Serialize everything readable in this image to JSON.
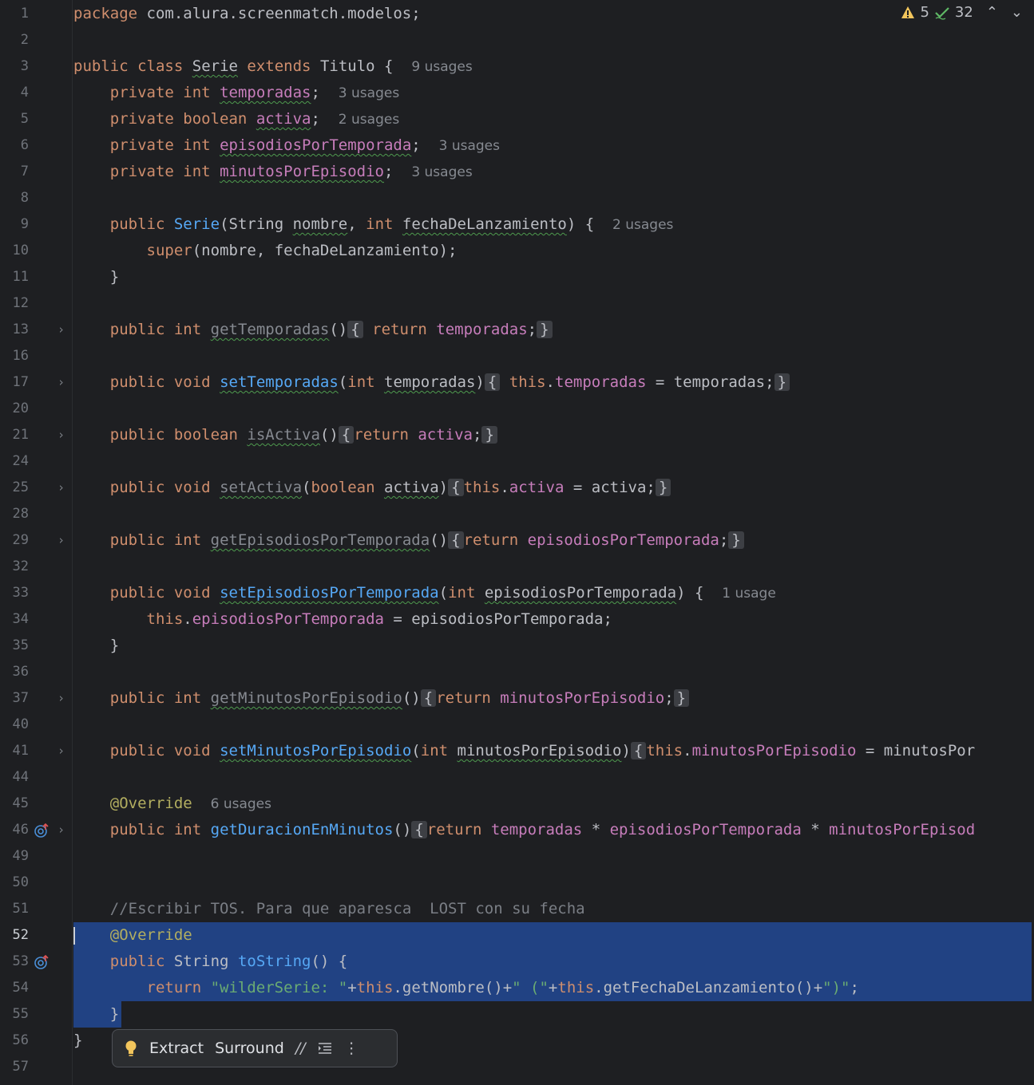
{
  "inspections": {
    "warnings": "5",
    "checks": "32"
  },
  "hints": {
    "usages_9": "9 usages",
    "usages_3": "3 usages",
    "usages_2": "2 usages",
    "usages_1": "1 usage",
    "usages_6": "6 usages"
  },
  "line_numbers": [
    "1",
    "2",
    "3",
    "4",
    "5",
    "6",
    "7",
    "8",
    "9",
    "10",
    "11",
    "12",
    "13",
    "16",
    "17",
    "20",
    "21",
    "24",
    "25",
    "28",
    "29",
    "32",
    "33",
    "34",
    "35",
    "36",
    "37",
    "40",
    "41",
    "44",
    "45",
    "46",
    "49",
    "50",
    "51",
    "52",
    "53",
    "54",
    "55",
    "56",
    "57"
  ],
  "code": {
    "package_kw": "package",
    "package_name": " com.alura.screenmatch.modelos;",
    "public": "public",
    "class": "class",
    "serie": "Serie",
    "extends": "extends",
    "titulo": "Titulo",
    "private": "private",
    "int": "int",
    "boolean": "boolean",
    "void": "void",
    "string": "String",
    "super": "super",
    "this": "this",
    "return": "return",
    "temporadas": "temporadas",
    "activa": "activa",
    "episodiosPorTemporada": "episodiosPorTemporada",
    "minutosPorEpisodio": "minutosPorEpisodio",
    "nombre": "nombre",
    "fechaDeLanzamiento": "fechaDeLanzamiento",
    "getTemporadas": "getTemporadas",
    "setTemporadas": "setTemporadas",
    "isActiva": "isActiva",
    "setActiva": "setActiva",
    "getEpisodiosPorTemporada": "getEpisodiosPorTemporada",
    "setEpisodiosPorTemporada": "setEpisodiosPorTemporada",
    "getMinutosPorEpisodio": "getMinutosPorEpisodio",
    "setMinutosPorEpisodio": "setMinutosPorEpisodio",
    "override": "@Override",
    "getDuracionEnMinutos": "getDuracionEnMinutos",
    "minutosPorEpisod_trunc": "minutosPorEpisod",
    "minutosPor_trunc": "minutosPor",
    "comment": "//Escribir TOS. Para que aparesca  LOST con su fecha",
    "toString": "toString",
    "str_open": "\"wilderSerie: \"",
    "getNombre": "getNombre",
    "str_paren": "\" (\"",
    "getFecha": "getFechaDeLanzamiento",
    "str_close": "\")\""
  },
  "popup": {
    "extract": "Extract",
    "surround": "Surround"
  },
  "colors": {
    "background": "#1e1f22",
    "selection": "#214283",
    "keyword": "#cf8e6d",
    "field": "#c77dbb",
    "method": "#56a8f5",
    "string": "#6aab73",
    "annotation": "#b3ae60"
  }
}
